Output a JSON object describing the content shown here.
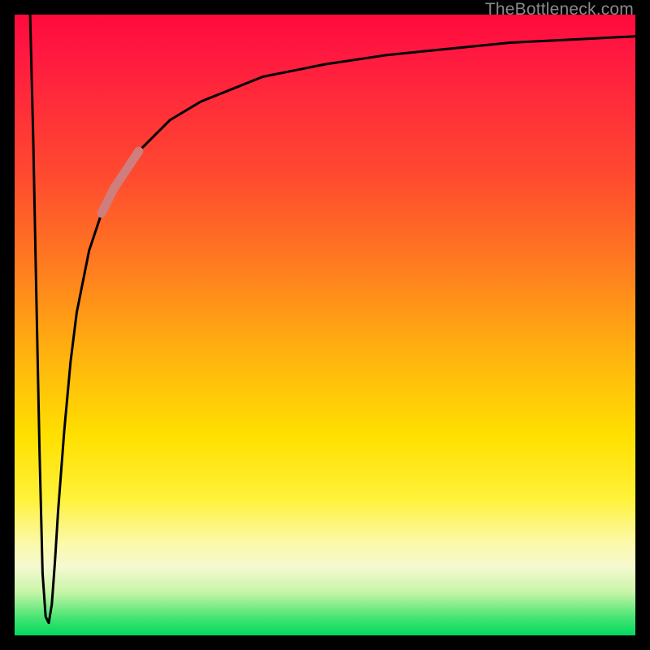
{
  "attribution": "TheBottleneck.com",
  "colors": {
    "frame": "#000000",
    "curve_main": "#000000",
    "curve_highlight": "#cf7d7d",
    "gradient_top": "#ff0a3c",
    "gradient_bottom": "#00d85f"
  },
  "chart_data": {
    "type": "line",
    "title": "",
    "xlabel": "",
    "ylabel": "",
    "xlim": [
      0,
      100
    ],
    "ylim": [
      0,
      100
    ],
    "grid": false,
    "series": [
      {
        "name": "curve",
        "x": [
          2.5,
          3.0,
          3.5,
          4.0,
          4.5,
          5.0,
          5.5,
          6.0,
          6.5,
          7.0,
          8.0,
          9.0,
          10.0,
          12.0,
          14.0,
          16.0,
          18.0,
          20.0,
          22.0,
          25.0,
          30.0,
          35.0,
          40.0,
          45.0,
          50.0,
          60.0,
          70.0,
          80.0,
          90.0,
          100.0
        ],
        "values": [
          100,
          80,
          55,
          30,
          10,
          3,
          2,
          5,
          12,
          20,
          33,
          44,
          52,
          62,
          68,
          72,
          75,
          78,
          80,
          83,
          86,
          88,
          90,
          91,
          92,
          93.5,
          94.5,
          95.5,
          96.0,
          96.5
        ]
      }
    ],
    "highlight_segment": {
      "series": "curve",
      "x_start": 14.0,
      "x_end": 20.0
    }
  }
}
